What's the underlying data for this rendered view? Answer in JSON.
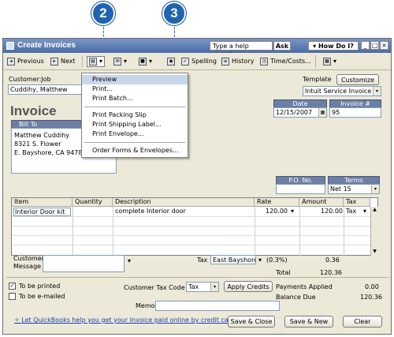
{
  "callouts": {
    "step2": "2",
    "step3": "3"
  },
  "window": {
    "title": "Create Invoices",
    "help_placeholder": "Type a help question",
    "ask_label": "Ask",
    "how_do_i_label": "How Do I?",
    "min": "_",
    "max": "□",
    "close": "×"
  },
  "toolbar": {
    "previous": "Previous",
    "next": "Next",
    "spelling": "Spelling",
    "history": "History",
    "time_costs": "Time/Costs..."
  },
  "form": {
    "customer_job_label": "Customer:Job",
    "customer_value": "Cuddihy, Matthew",
    "template_label": "Template",
    "customize_label": "Customize",
    "template_value": "Intuit Service Invoice",
    "invoice_title": "Invoice",
    "date_label": "Date",
    "date_value": "12/15/2007",
    "invoice_no_label": "Invoice #",
    "invoice_no_value": "95",
    "bill_to_label": "Bill To",
    "bill_to_lines": [
      "Matthew Cuddihy",
      "8321 S. Flower",
      "E. Bayshore, CA  94781"
    ],
    "po_label": "P.O. No.",
    "terms_label": "Terms",
    "terms_value": "Net 15"
  },
  "grid": {
    "columns": [
      "Item",
      "Quantity",
      "Description",
      "Rate",
      "Amount",
      "Tax"
    ],
    "rows": [
      {
        "item": "Interior Door kit",
        "quantity": "",
        "description": "complete Interior door",
        "rate": "120.00",
        "amount": "120.00",
        "tax": "Tax"
      }
    ]
  },
  "totals": {
    "customer_message_label": "Customer\nMessage",
    "tax_label": "Tax",
    "tax_item": "East Bayshore",
    "tax_rate": "(0.3%)",
    "tax_amount": "0.36",
    "total_label": "Total",
    "total_value": "120.36",
    "customer_tax_code_label": "Customer Tax Code",
    "customer_tax_code_value": "Tax",
    "apply_credits_label": "Apply Credits",
    "payments_applied_label": "Payments Applied",
    "payments_applied_value": "0.00",
    "balance_due_label": "Balance Due",
    "balance_due_value": "120.36",
    "memo_label": "Memo",
    "to_be_printed": "To be printed",
    "to_be_emailed": "To be e-mailed",
    "online_link": "Let QuickBooks help you get your Invoice paid online by credit card."
  },
  "buttons": {
    "save_close": "Save & Close",
    "save_new": "Save & New",
    "clear": "Clear"
  },
  "print_menu": {
    "items": [
      "Preview",
      "Print...",
      "Print Batch...",
      "Print Packing Slip",
      "Print Shipping Label...",
      "Print Envelope...",
      "Order Forms & Envelopes..."
    ]
  }
}
